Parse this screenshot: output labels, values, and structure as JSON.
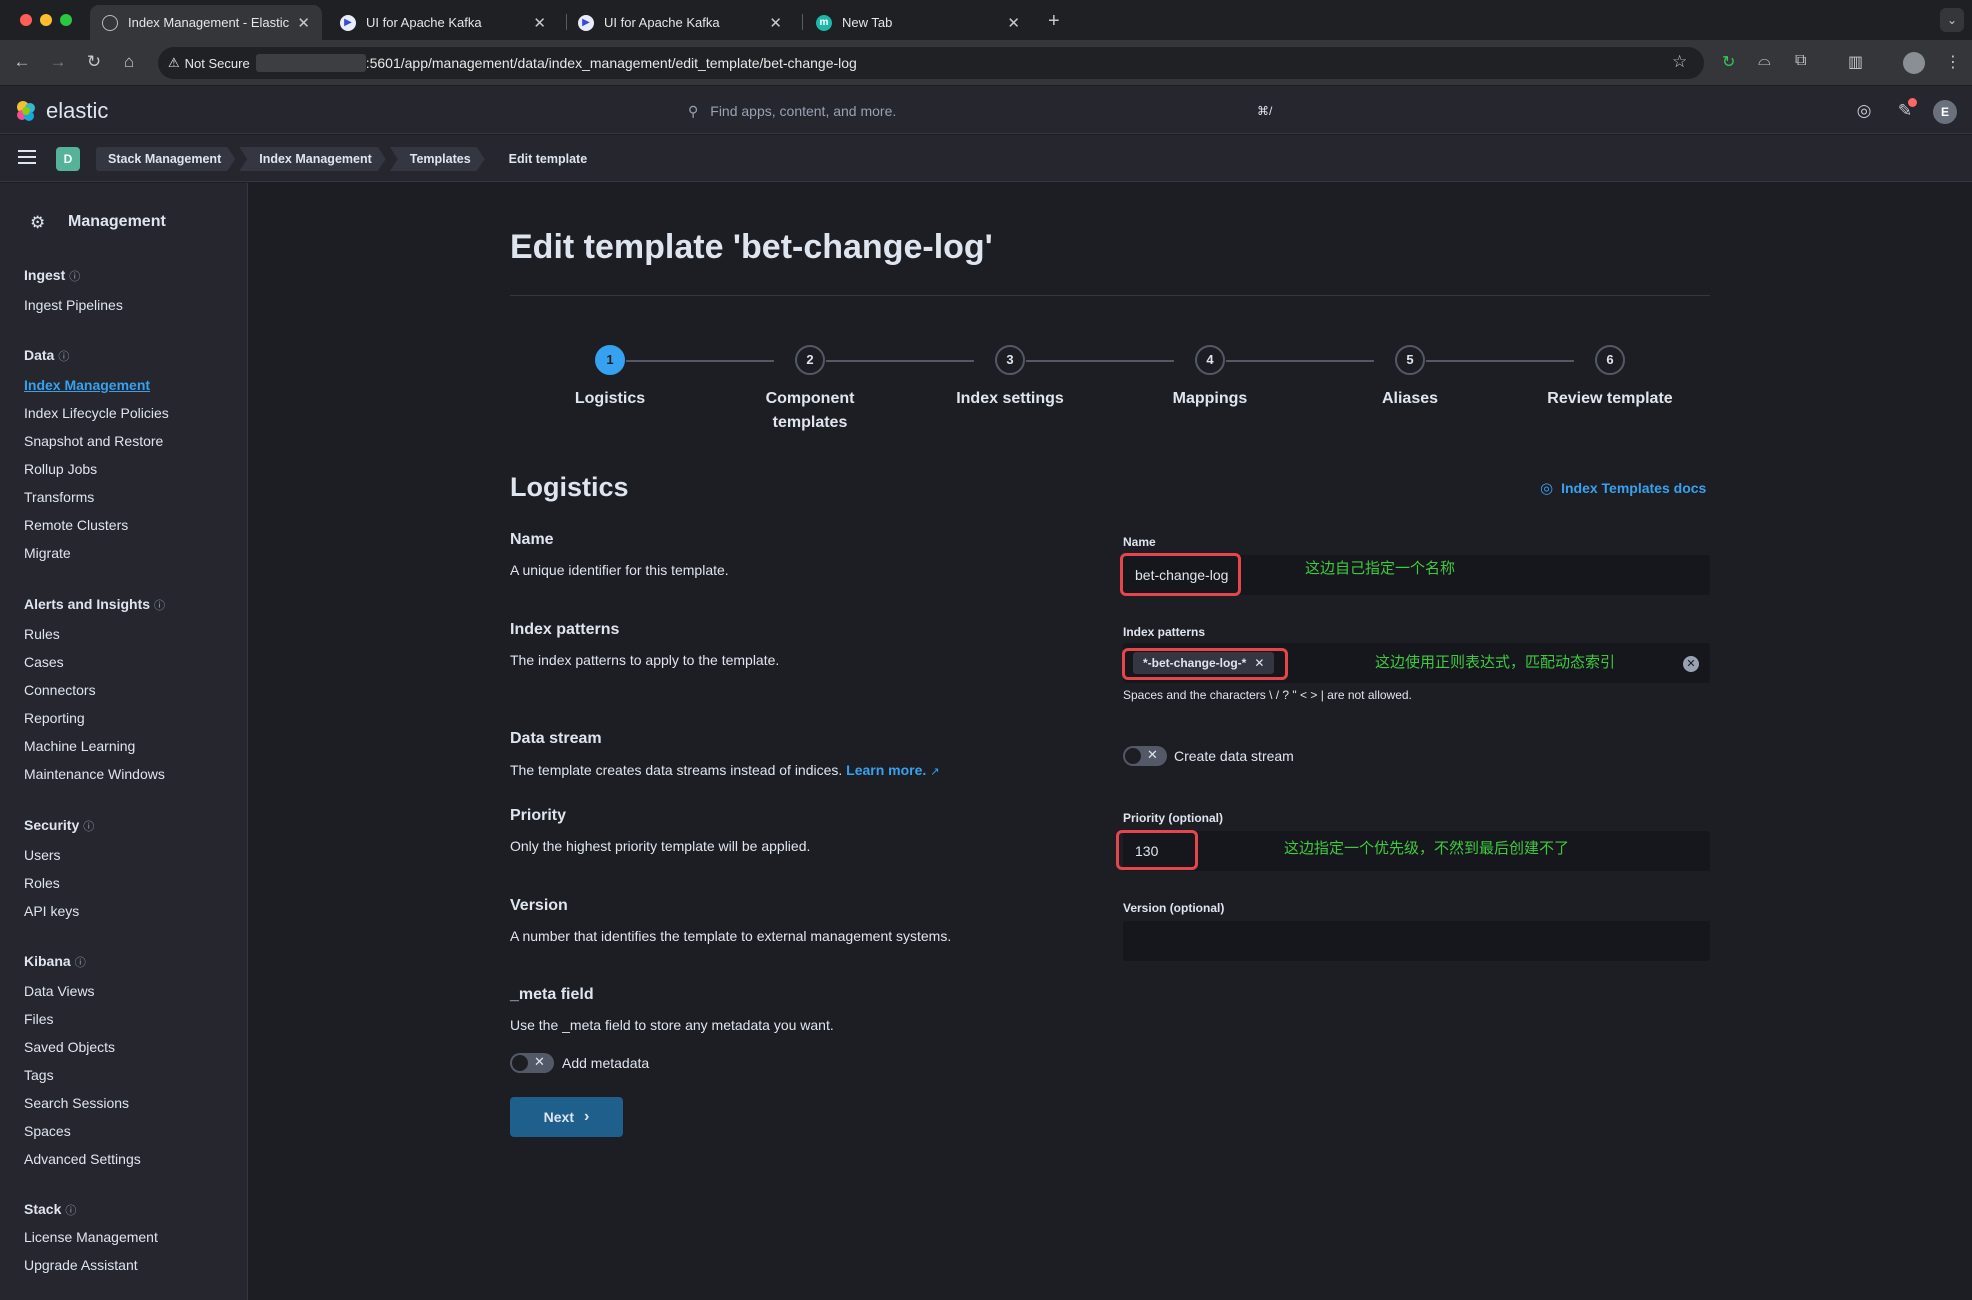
{
  "browser": {
    "tabs": [
      {
        "title": "Index Management - Elastic",
        "active": true,
        "icon": "elastic-favicon"
      },
      {
        "title": "UI for Apache Kafka",
        "active": false,
        "icon": "kafka-ui-favicon"
      },
      {
        "title": "UI for Apache Kafka",
        "active": false,
        "icon": "kafka-ui-favicon"
      },
      {
        "title": "New Tab",
        "active": false,
        "icon": "new-tab-favicon"
      }
    ],
    "not_secure": "Not Secure",
    "url": ":5601/app/management/data/index_management/edit_template/bet-change-log"
  },
  "header": {
    "logo_text": "elastic",
    "search_placeholder": "Find apps, content, and more.",
    "search_shortcut": "⌘/",
    "avatar": "E"
  },
  "breadcrumbs": {
    "space": "D",
    "items": [
      "Stack Management",
      "Index Management",
      "Templates",
      "Edit template"
    ]
  },
  "sidebar": {
    "title": "Management",
    "groups": [
      {
        "heading": "Ingest",
        "items": [
          "Ingest Pipelines"
        ]
      },
      {
        "heading": "Data",
        "items": [
          "Index Management",
          "Index Lifecycle Policies",
          "Snapshot and Restore",
          "Rollup Jobs",
          "Transforms",
          "Remote Clusters",
          "Migrate"
        ]
      },
      {
        "heading": "Alerts and Insights",
        "items": [
          "Rules",
          "Cases",
          "Connectors",
          "Reporting",
          "Machine Learning",
          "Maintenance Windows"
        ]
      },
      {
        "heading": "Security",
        "items": [
          "Users",
          "Roles",
          "API keys"
        ]
      },
      {
        "heading": "Kibana",
        "items": [
          "Data Views",
          "Files",
          "Saved Objects",
          "Tags",
          "Search Sessions",
          "Spaces",
          "Advanced Settings"
        ]
      },
      {
        "heading": "Stack",
        "items": [
          "License Management",
          "Upgrade Assistant"
        ]
      }
    ]
  },
  "page": {
    "title": "Edit template 'bet-change-log'",
    "steps": [
      {
        "num": "1",
        "label": "Logistics"
      },
      {
        "num": "2",
        "label": "Component templates"
      },
      {
        "num": "3",
        "label": "Index settings"
      },
      {
        "num": "4",
        "label": "Mappings"
      },
      {
        "num": "5",
        "label": "Aliases"
      },
      {
        "num": "6",
        "label": "Review template"
      }
    ],
    "section_title": "Logistics",
    "docs_link": "Index Templates docs",
    "fields": {
      "name": {
        "title": "Name",
        "desc": "A unique identifier for this template.",
        "label": "Name",
        "value": "bet-change-log",
        "annotation": "这边自己指定一个名称"
      },
      "index_patterns": {
        "title": "Index patterns",
        "desc": "The index patterns to apply to the template.",
        "label": "Index patterns",
        "pill": "*-bet-change-log-*",
        "help": "Spaces and the characters \\ / ? \" < > | are not allowed.",
        "annotation": "这边使用正则表达式，匹配动态索引"
      },
      "data_stream": {
        "title": "Data stream",
        "desc": "The template creates data streams instead of indices.",
        "learn_more": "Learn more.",
        "toggle_label": "Create data stream"
      },
      "priority": {
        "title": "Priority",
        "desc": "Only the highest priority template will be applied.",
        "label": "Priority (optional)",
        "value": "130",
        "annotation": "这边指定一个优先级，不然到最后创建不了"
      },
      "version": {
        "title": "Version",
        "desc": "A number that identifies the template to external management systems.",
        "label": "Version (optional)",
        "value": ""
      },
      "meta": {
        "title": "_meta field",
        "desc": "Use the _meta field to store any metadata you want.",
        "toggle_label": "Add metadata"
      }
    },
    "next_label": "Next"
  }
}
